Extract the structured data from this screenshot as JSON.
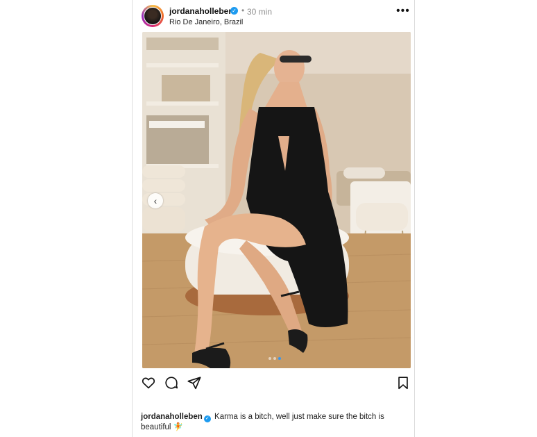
{
  "post": {
    "username": "jordanaholleben",
    "dot": "•",
    "time": "30 min",
    "location": "Rio De Janeiro, Brazil",
    "more": "•••",
    "verified_glyph": "✓",
    "carousel": {
      "count": 3,
      "active_index": 2
    },
    "prev_glyph": "‹"
  },
  "actions": {
    "like_icon": "heart-icon",
    "comment_icon": "comment-icon",
    "share_icon": "send-icon",
    "save_icon": "bookmark-icon"
  },
  "caption": {
    "username": "jordanaholleben",
    "text": "Karma is a bitch, well just make sure the bitch is beautiful",
    "emoji": "🧚"
  },
  "colors": {
    "verified": "#1d9bf0",
    "dot_active": "#3897f0",
    "muted_text": "#8e8e8e"
  }
}
